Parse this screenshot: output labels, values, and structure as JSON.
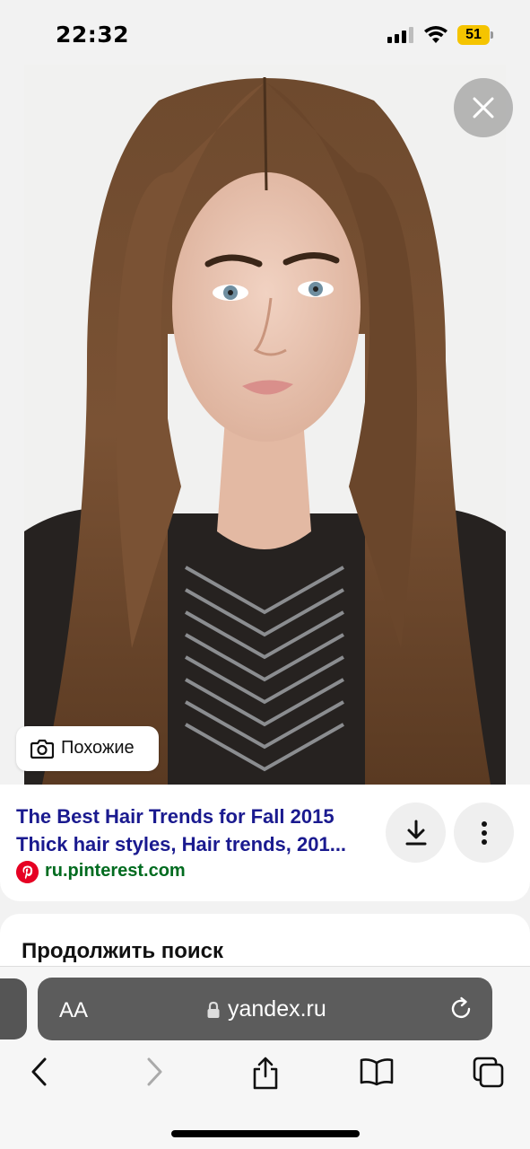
{
  "status_bar": {
    "time": "22:32",
    "battery": "51"
  },
  "image_viewer": {
    "similar_label": "Похожие"
  },
  "result": {
    "title_line1": "The Best Hair Trends for Fall 2015",
    "title_line2": "Thick hair styles, Hair trends, 201...",
    "domain": "ru.pinterest.com"
  },
  "continue_search": {
    "title": "Продолжить поиск"
  },
  "browser": {
    "text_size_label": "AA",
    "url": "yandex.ru"
  },
  "colors": {
    "title_link": "#1a1a8f",
    "domain_green": "#006b1f",
    "battery": "#f5c400",
    "pinterest_red": "#e60023"
  },
  "icons": [
    "close-icon",
    "camera-icon",
    "download-icon",
    "more-vertical-icon",
    "pinterest-icon",
    "lock-icon",
    "reload-icon",
    "back-icon",
    "forward-icon",
    "share-icon",
    "bookmarks-icon",
    "tabs-icon"
  ]
}
